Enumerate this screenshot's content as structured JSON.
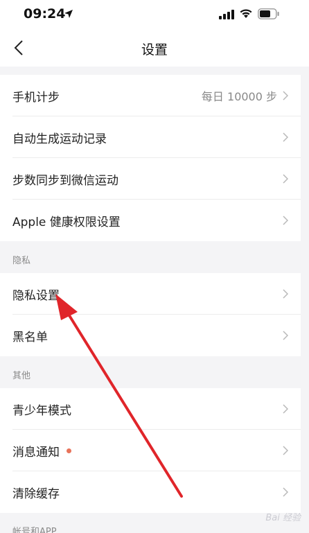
{
  "status_bar": {
    "time": "09:24"
  },
  "nav": {
    "title": "设置"
  },
  "group1": {
    "rows": [
      {
        "label": "手机计步",
        "value": "每日 10000 步"
      },
      {
        "label": "自动生成运动记录"
      },
      {
        "label": "步数同步到微信运动"
      },
      {
        "label": "Apple 健康权限设置"
      }
    ]
  },
  "privacy": {
    "header": "隐私",
    "rows": [
      {
        "label": "隐私设置"
      },
      {
        "label": "黑名单"
      }
    ]
  },
  "other": {
    "header": "其他",
    "rows": [
      {
        "label": "青少年模式"
      },
      {
        "label": "消息通知"
      },
      {
        "label": "清除缓存"
      }
    ]
  },
  "account": {
    "header": "帐号和APP"
  },
  "colors": {
    "annotation_arrow": "#e0252a",
    "badge_dot": "#e8735a",
    "background": "#f4f4f6"
  },
  "watermark": "Bai 经验"
}
